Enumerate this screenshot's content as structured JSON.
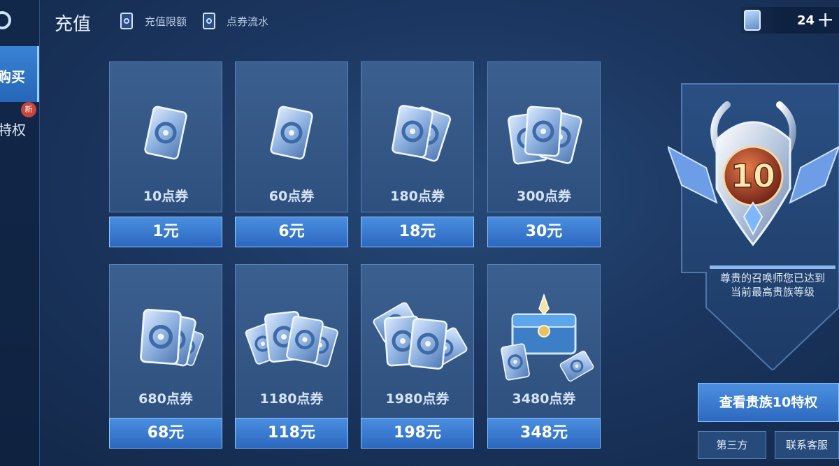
{
  "sidebar": {
    "buy_label": "购买",
    "privilege_label": "特权",
    "new_badge": "新"
  },
  "header": {
    "title": "充值",
    "links": [
      "充值限额",
      "点券流水"
    ],
    "currency": {
      "icon": "coupon-icon",
      "amount": "24",
      "add": "+"
    }
  },
  "products": [
    {
      "coupons": "10点券",
      "price": "1元"
    },
    {
      "coupons": "60点券",
      "price": "6元"
    },
    {
      "coupons": "180点券",
      "price": "18元"
    },
    {
      "coupons": "300点券",
      "price": "30元"
    },
    {
      "coupons": "680点券",
      "price": "68元"
    },
    {
      "coupons": "1180点券",
      "price": "118元"
    },
    {
      "coupons": "1980点券",
      "price": "198元"
    },
    {
      "coupons": "3480点券",
      "price": "348元"
    }
  ],
  "noble": {
    "level": "10",
    "message_line1": "尊贵的召唤师您已达到",
    "message_line2": "当前最高贵族等级",
    "view_button": "查看贵族10特权",
    "third_party": "第三方",
    "support": "联系客服"
  },
  "colors": {
    "accent": "#3a83d4",
    "badge": "#c9463c",
    "button": "#2b68bf"
  }
}
